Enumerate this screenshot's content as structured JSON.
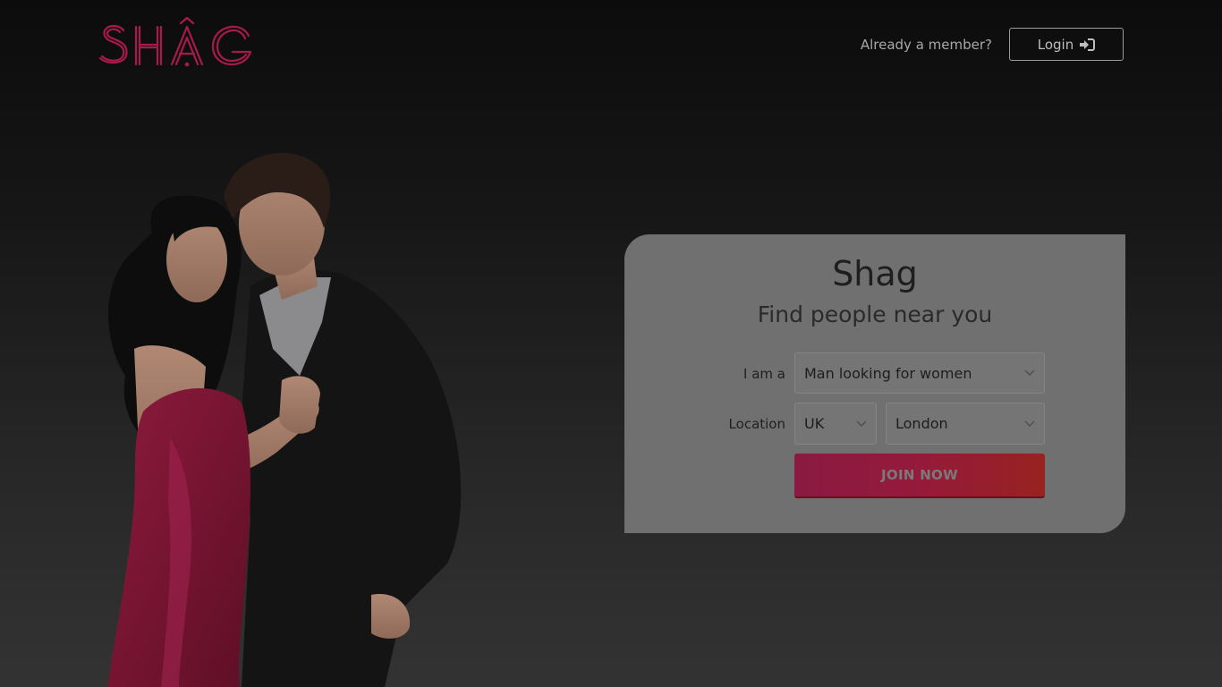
{
  "header": {
    "logo_text": "SHAG",
    "member_text": "Already a member?",
    "login_label": "Login"
  },
  "card": {
    "title": "Shag",
    "subtitle": "Find people near you",
    "iam_label": "I am a",
    "iam_value": "Man looking for women",
    "location_label": "Location",
    "country_value": "UK",
    "city_value": "London",
    "join_label": "JOIN NOW"
  },
  "colors": {
    "brand": "#c21d5a",
    "button_start": "#8a1a42",
    "button_end": "#982220",
    "card_bg": "#707070"
  },
  "icons": {
    "login": "sign-in-icon",
    "dropdown": "chevron-down-icon"
  }
}
